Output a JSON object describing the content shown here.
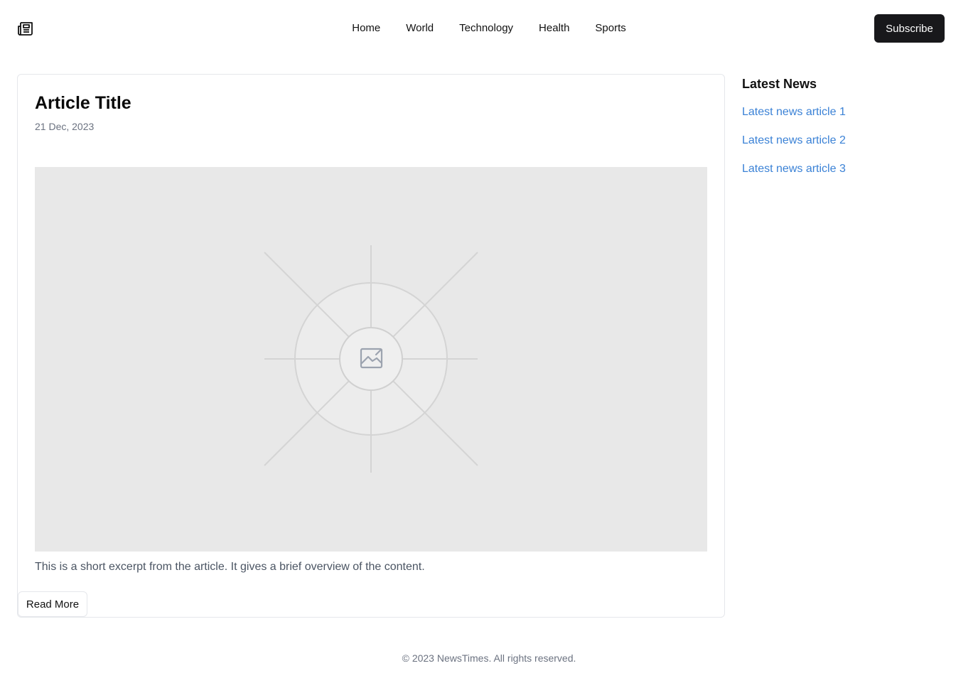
{
  "header": {
    "logo_icon": "newspaper-icon",
    "nav": [
      {
        "label": "Home"
      },
      {
        "label": "World"
      },
      {
        "label": "Technology"
      },
      {
        "label": "Health"
      },
      {
        "label": "Sports"
      }
    ],
    "subscribe_label": "Subscribe"
  },
  "article": {
    "title": "Article Title",
    "date": "21 Dec, 2023",
    "image_icon": "image-placeholder-icon",
    "excerpt": "This is a short excerpt from the article. It gives a brief overview of the content.",
    "read_more_label": "Read More"
  },
  "sidebar": {
    "title": "Latest News",
    "items": [
      {
        "label": "Latest news article 1"
      },
      {
        "label": "Latest news article 2"
      },
      {
        "label": "Latest news article 3"
      }
    ]
  },
  "footer": {
    "text": "© 2023 NewsTimes. All rights reserved."
  },
  "colors": {
    "link": "#3b82d6",
    "button_dark": "#18181b",
    "placeholder_bg": "#e8e8e8"
  }
}
